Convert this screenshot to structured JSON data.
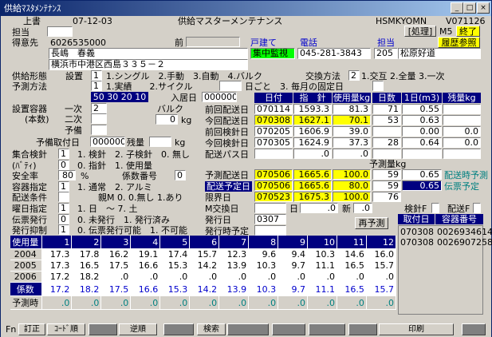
{
  "window": {
    "title": "供給ﾏｽﾀﾒﾝﾃﾅﾝｽ",
    "min": "_",
    "max": "□",
    "close": "×"
  },
  "header": {
    "kind": "上書",
    "date": "07-12-03",
    "screen_title": "供給マスターメンテナンス",
    "program": "HSMKYOMN",
    "version": "V071126",
    "tanto_label": "担当",
    "shori_btn": "[処理]",
    "mode": "M5",
    "end_btn": "終了",
    "history_btn": "履歴参照"
  },
  "customer": {
    "label": "得意先",
    "code": "6026535000",
    "mae_label": "前",
    "name": "長嶋　春義",
    "address": "横浜市中港区西島３３５－２",
    "house_type": "戸建て",
    "monitor": "集中監視",
    "tel_label": "電話",
    "tel": "045-281-3843",
    "tanto_label": "担当",
    "tanto_code": "205",
    "tanto_name": "松原好道"
  },
  "supply": {
    "form_label": "供給形態",
    "setting_label": "設置",
    "setting_val": "1",
    "setting_opts": "1.シングル　2.手動　3.自動　4.バルク",
    "exchange_label": "交換方法",
    "exchange_val": "2",
    "exchange_opts": "1.交互 2.全量 3.一次",
    "forecast_label": "予測方法",
    "forecast_val": "1",
    "forecast_opts": "1.実績　　2.サイクル",
    "goto": "日ごと　3. 毎月の固定日",
    "sizes": "50 30 20 10",
    "nyukyo_label": "入居日",
    "nyukyo": "000000"
  },
  "container": {
    "label": "設置容器",
    "sub": "(本数)",
    "ichiji_label": "一次",
    "ichiji": "2",
    "niji_label": "二次",
    "yobi_label": "予備",
    "bulk_label": "バルク",
    "bulk_val": "0",
    "bulk_unit": "kg",
    "yobi_date_label": "予備取付日",
    "yobi_date": "000000",
    "zan_label": "残量",
    "zan_unit": "kg"
  },
  "dates": {
    "headers": [
      "日付",
      "指　針",
      "使用量kg",
      "日数",
      "1日(m3)",
      "残量kg"
    ],
    "rows": [
      {
        "label": "前回配送日",
        "date": "070114",
        "meter": "1593.3",
        "usage": "81.3",
        "days": "71",
        "daily": "0.55",
        "rem": ""
      },
      {
        "label": "今回配送日",
        "date": "070308",
        "meter": "1627.1",
        "usage": "70.1",
        "days": "53",
        "daily": "0.63",
        "rem": ""
      },
      {
        "label": "前回検針日",
        "date": "070205",
        "meter": "1606.9",
        "usage": "39.0",
        "days": "",
        "daily": "0.00",
        "rem": "0.0"
      },
      {
        "label": "今回検針日",
        "date": "070305",
        "meter": "1624.9",
        "usage": "37.3",
        "days": "28",
        "daily": "0.64",
        "rem": "0.0"
      },
      {
        "label": "配送パス日",
        "date": "",
        "meter": ".0",
        "usage": ".0",
        "days": "",
        "daily": "",
        "rem": ""
      }
    ]
  },
  "forecast": {
    "title": "予測量kg",
    "rows": [
      {
        "label": "予測配送日",
        "date": "070506",
        "meter": "1665.6",
        "usage": "100.0",
        "days": "59",
        "daily": "0.65",
        "note": "配送時予測"
      },
      {
        "label": "配送予定日",
        "date": "070506",
        "meter": "1665.6",
        "usage": "80.0",
        "days": "59",
        "daily": "0.65",
        "note": "伝票予定"
      },
      {
        "label": "限界日",
        "date": "070523",
        "meter": "1675.3",
        "usage": "100.0",
        "days": "76",
        "daily": "",
        "note": ""
      }
    ],
    "m_exchange_label": "M交換日",
    "m_exchange_mid": "日",
    "m_exchange_val": ".0",
    "new_label": "新",
    "new_val": ".0",
    "issue_label": "発行日",
    "issue_val": "0307",
    "issue_plan_label": "発行時予定",
    "yosoku_btn": "再予測"
  },
  "meter_flags": {
    "kenshin_label": "検針F",
    "haiso_label": "配送F"
  },
  "options": [
    {
      "label": "集合検針",
      "val": "1",
      "opts": "1. 検針　2. 子検針　0. 無し"
    },
    {
      "label": "(ﾊﾞﾃｨ)",
      "val": "0",
      "opts": "0. 指針　1. 使用量"
    },
    {
      "label": "安全率",
      "val": "80",
      "opts": "%",
      "extra_label": "係数番号",
      "extra_val": "0"
    },
    {
      "label": "容器指定",
      "val": "1",
      "opts": "1. 通常　2. アルミ"
    },
    {
      "label": "配送条件",
      "val": "",
      "opts": "親M 0. 0.無し 1.あり"
    },
    {
      "label": "曜日指定",
      "val": "1",
      "opts": "1. 日　～ 7. 土"
    },
    {
      "label": "伝票発行",
      "val": "0",
      "opts": "0. 未発行　1. 発行済み"
    },
    {
      "label": "発行抑制",
      "val": "1",
      "opts": "0. 伝票発行可能　1. 不可能"
    }
  ],
  "tanks": {
    "headers": [
      "取付日",
      "容器番号"
    ],
    "rows": [
      [
        "070308",
        "0026934614"
      ],
      [
        "070308",
        "0026907258"
      ]
    ]
  },
  "usage": {
    "header": "使用量",
    "months": [
      "1",
      "2",
      "3",
      "4",
      "5",
      "6",
      "7",
      "8",
      "9",
      "10",
      "11",
      "12"
    ],
    "rows": [
      {
        "label": "2004",
        "vals": [
          "17.3",
          "17.8",
          "16.2",
          "19.1",
          "17.4",
          "15.7",
          "12.3",
          "9.6",
          "9.4",
          "10.3",
          "14.6",
          "16.0"
        ]
      },
      {
        "label": "2005",
        "vals": [
          "17.3",
          "16.5",
          "17.5",
          "16.6",
          "15.3",
          "14.2",
          "13.9",
          "10.3",
          "9.7",
          "11.1",
          "16.5",
          "15.7"
        ]
      },
      {
        "label": "2006",
        "vals": [
          "17.2",
          "18.2",
          ".0",
          ".0",
          ".0",
          ".0",
          ".0",
          ".0",
          ".0",
          ".0",
          ".0",
          ".0"
        ]
      },
      {
        "label": "係数",
        "vals": [
          "17.2",
          "18.2",
          "17.5",
          "16.6",
          "15.3",
          "14.2",
          "13.9",
          "10.3",
          "9.7",
          "11.1",
          "16.5",
          "15.7"
        ]
      },
      {
        "label": "予測時",
        "vals": [
          ".0",
          ".0",
          ".0",
          ".0",
          ".0",
          ".0",
          ".0",
          ".0",
          ".0",
          ".0",
          ".0",
          ".0"
        ]
      }
    ]
  },
  "fnkeys": {
    "fn": "Fn",
    "keys": [
      "訂正",
      "ｺｰﾄﾞ順",
      "",
      "逆順",
      "",
      "検索",
      "",
      "",
      "",
      "",
      "印刷",
      ""
    ]
  }
}
